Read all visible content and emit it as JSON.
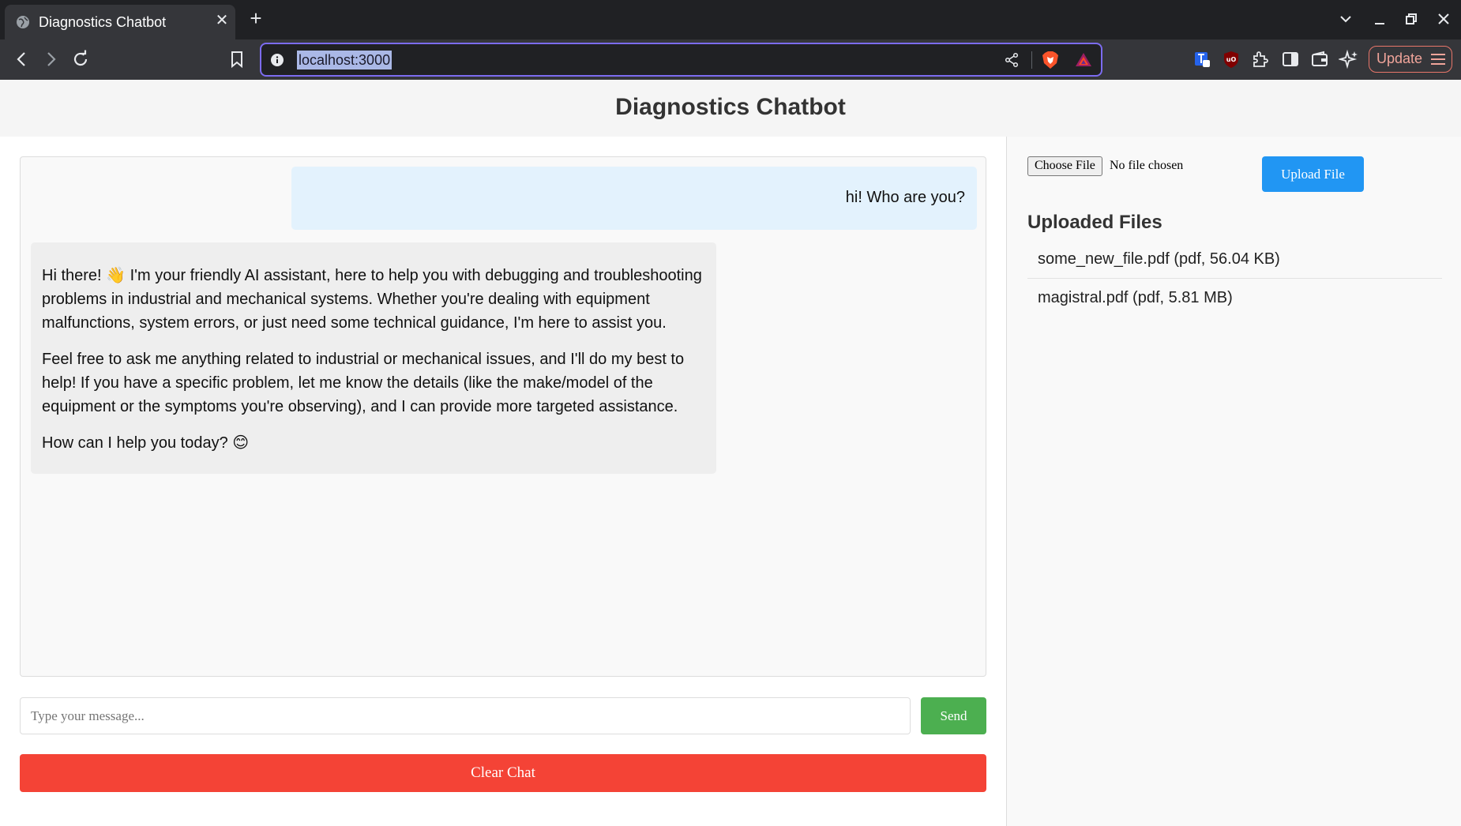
{
  "browser": {
    "tab_title": "Diagnostics Chatbot",
    "url": "localhost:3000",
    "update_label": "Update"
  },
  "app": {
    "title": "Diagnostics Chatbot"
  },
  "chat": {
    "messages": [
      {
        "role": "user",
        "text": "hi! Who are you?"
      },
      {
        "role": "assistant",
        "paragraphs": [
          "Hi there! 👋 I'm your friendly AI assistant, here to help you with debugging and troubleshooting problems in industrial and mechanical systems. Whether you're dealing with equipment malfunctions, system errors, or just need some technical guidance, I'm here to assist you.",
          "Feel free to ask me anything related to industrial or mechanical issues, and I'll do my best to help! If you have a specific problem, let me know the details (like the make/model of the equipment or the symptoms you're observing), and I can provide more targeted assistance.",
          "How can I help you today? 😊"
        ]
      }
    ],
    "input_placeholder": "Type your message...",
    "input_value": "",
    "send_label": "Send",
    "clear_label": "Clear Chat"
  },
  "upload": {
    "choose_label": "Choose File",
    "no_file_label": "No file chosen",
    "upload_label": "Upload File",
    "heading": "Uploaded Files",
    "files": [
      "some_new_file.pdf (pdf, 56.04 KB)",
      "magistral.pdf (pdf, 5.81 MB)"
    ]
  },
  "colors": {
    "send": "#4caf50",
    "clear": "#f44336",
    "upload": "#2196f3",
    "user_bubble": "#e3f2fd",
    "assistant_bubble": "#eeeeee"
  }
}
